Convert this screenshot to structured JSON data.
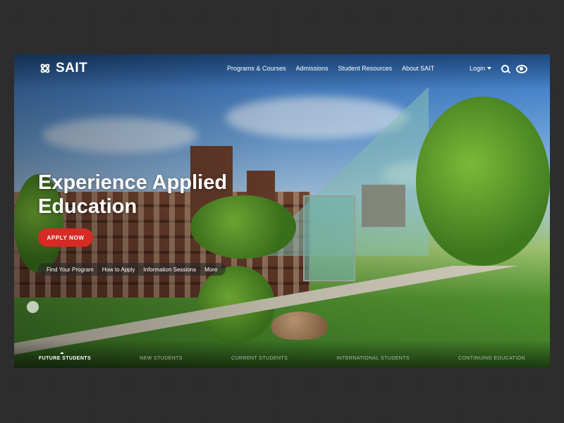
{
  "brand": {
    "name": "SAIT"
  },
  "nav": {
    "items": [
      "Programs & Courses",
      "Admissions",
      "Student Resources",
      "About SAIT"
    ]
  },
  "utility": {
    "login_label": "Login",
    "icons": [
      "search-icon",
      "eye-icon"
    ]
  },
  "hero": {
    "title_line1": "Experience Applied",
    "title_line2": "Education",
    "cta_label": "APPLY NOW",
    "quick_links": [
      "Find Your Program",
      "How to Apply",
      "Information Sessions",
      "More"
    ]
  },
  "audience_tabs": {
    "items": [
      "FUTURE STUDENTS",
      "NEW STUDENTS",
      "CURRENT STUDENTS",
      "INTERNATIONAL STUDENTS",
      "CONTINUING EDUCATION"
    ],
    "active_index": 0
  },
  "colors": {
    "cta": "#d72a24",
    "page_bg": "#2b2b2c"
  }
}
